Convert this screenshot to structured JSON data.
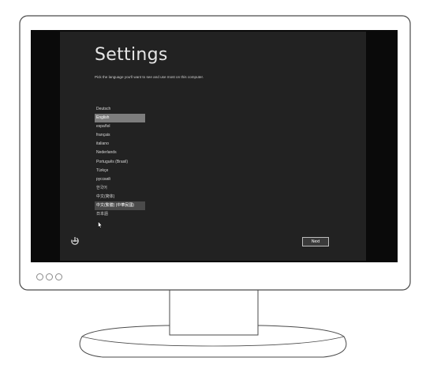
{
  "setup": {
    "title": "Settings",
    "subtitle": "Pick the language you'll want to see and use most on this computer.",
    "languages": [
      {
        "label": "Deutsch"
      },
      {
        "label": "English"
      },
      {
        "label": "español"
      },
      {
        "label": "français"
      },
      {
        "label": "italiano"
      },
      {
        "label": "Nederlands"
      },
      {
        "label": "Português (Brasil)"
      },
      {
        "label": "Türkçe"
      },
      {
        "label": "русский"
      },
      {
        "label": "한국어"
      },
      {
        "label": "中文(简体)"
      },
      {
        "label": "中文(繁體) (中華民國)"
      },
      {
        "label": "日本語"
      }
    ],
    "selected_language": "English",
    "hovered_language": "中文(繁體) (中華民國)",
    "next_label": "Next",
    "accessibility_icon": "ease-of-access-icon"
  },
  "monitor": {
    "power_buttons": [
      "bezel-button",
      "bezel-button",
      "bezel-button"
    ]
  },
  "colors": {
    "screen_bg": "#222222",
    "selected_bg": "#7d7d7d",
    "text": "#d8d8d8"
  }
}
